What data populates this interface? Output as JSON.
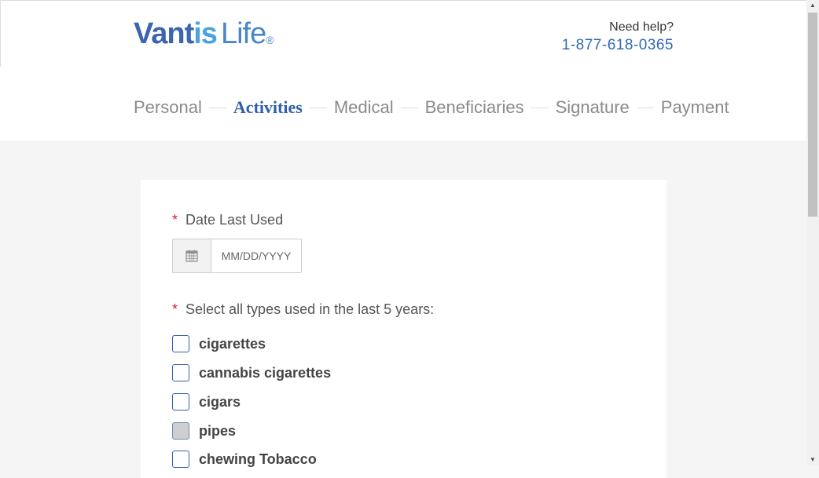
{
  "header": {
    "logo": {
      "vant": "Vant",
      "is": "is",
      "life": "Life",
      "reg": "®"
    },
    "help": {
      "label": "Need help?",
      "phone": "1-877-618-0365"
    }
  },
  "steps": [
    {
      "label": "Personal",
      "active": false
    },
    {
      "label": "Activities",
      "active": true
    },
    {
      "label": "Medical",
      "active": false
    },
    {
      "label": "Beneficiaries",
      "active": false
    },
    {
      "label": "Signature",
      "active": false
    },
    {
      "label": "Payment",
      "active": false
    }
  ],
  "form": {
    "date_last_used": {
      "required_mark": "*",
      "label": "Date Last Used",
      "placeholder": "MM/DD/YYYY",
      "value": ""
    },
    "types_question": {
      "required_mark": "*",
      "label": "Select all types used in the last 5 years:"
    },
    "options": [
      {
        "label": "cigarettes",
        "checked": false,
        "disabled": false
      },
      {
        "label": "cannabis cigarettes",
        "checked": false,
        "disabled": false
      },
      {
        "label": "cigars",
        "checked": false,
        "disabled": false
      },
      {
        "label": "pipes",
        "checked": false,
        "disabled": true
      },
      {
        "label": "chewing Tobacco",
        "checked": false,
        "disabled": false
      }
    ]
  },
  "colors": {
    "brand_blue": "#3c64b0",
    "brand_light_blue": "#4aa3dc",
    "active_step": "#2f5fad",
    "required": "#d0213a"
  },
  "icons": {
    "calendar": "calendar-icon"
  }
}
